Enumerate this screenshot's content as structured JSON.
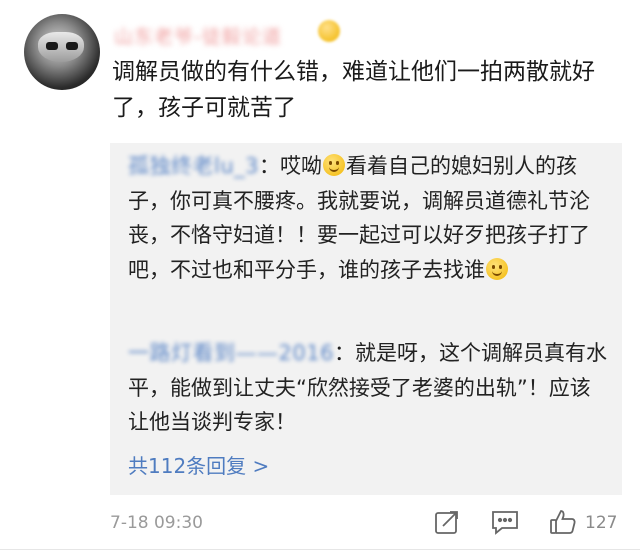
{
  "comment": {
    "username": "山东老爷-徒毅论道",
    "text": "调解员做的有什么错，难道让他们一拍两散就好了，孩子可就苦了"
  },
  "replies": [
    {
      "author": "孤独终老lu_3",
      "seg1": "：哎呦",
      "emoji1": "smile-emoji",
      "seg2": "看着自己的媳妇别人的孩子，你可真不腰疼。我就要说，调解员道德礼节沦丧，不恪守妇道！！要一起过可以好歹把孩子打了吧，不过也和平分手，谁的孩子去找谁",
      "emoji2": "smile-emoji"
    },
    {
      "author": "一路灯看到——2016",
      "text": "：就是呀，这个调解员真有水平，能做到让丈夫“欣然接受了老婆的出轨”！应该让他当谈判专家！"
    }
  ],
  "more_replies": "共112条回复 >",
  "footer": {
    "timestamp": "7-18 09:30",
    "like_count": "127",
    "icons": [
      "share-icon",
      "comment-icon",
      "like-icon"
    ]
  },
  "colors": {
    "link": "#4f7cc0",
    "reply_bg": "#f2f2f2",
    "timestamp": "#9a9a9a"
  }
}
